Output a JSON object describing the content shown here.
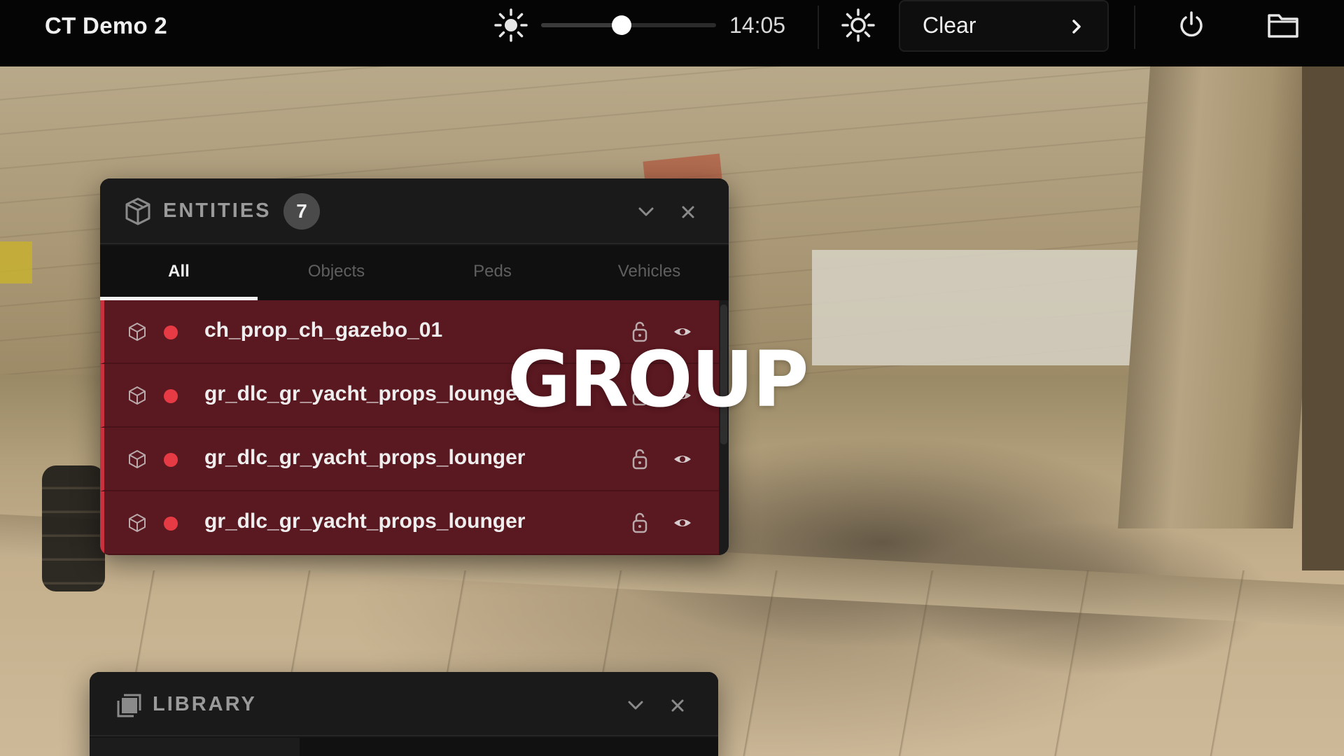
{
  "topbar": {
    "app_title": "CT Demo 2",
    "time_of_day": "14:05",
    "time_slider_value": 0.46,
    "weather_label": "Clear",
    "icons": [
      "sun-icon",
      "settings-sun-icon",
      "chevron-right-icon",
      "power-icon",
      "folder-icon"
    ]
  },
  "entities_panel": {
    "title": "ENTITIES",
    "count": "7",
    "tabs": [
      {
        "label": "All",
        "active": true
      },
      {
        "label": "Objects",
        "active": false
      },
      {
        "label": "Peds",
        "active": false
      },
      {
        "label": "Vehicles",
        "active": false
      }
    ],
    "items": [
      {
        "name": "ch_prop_ch_gazebo_01",
        "selected": true
      },
      {
        "name": "gr_dlc_gr_yacht_props_lounger",
        "selected": true
      },
      {
        "name": "gr_dlc_gr_yacht_props_lounger",
        "selected": true
      },
      {
        "name": "gr_dlc_gr_yacht_props_lounger",
        "selected": true
      }
    ]
  },
  "overlay_caption": "GROUP",
  "library_panel": {
    "title": "LIBRARY"
  },
  "colors": {
    "topbar_bg": "#050505",
    "panel_bg": "#151515",
    "selected_row_bg": "#5a1820",
    "status_dot": "#e63b44"
  }
}
